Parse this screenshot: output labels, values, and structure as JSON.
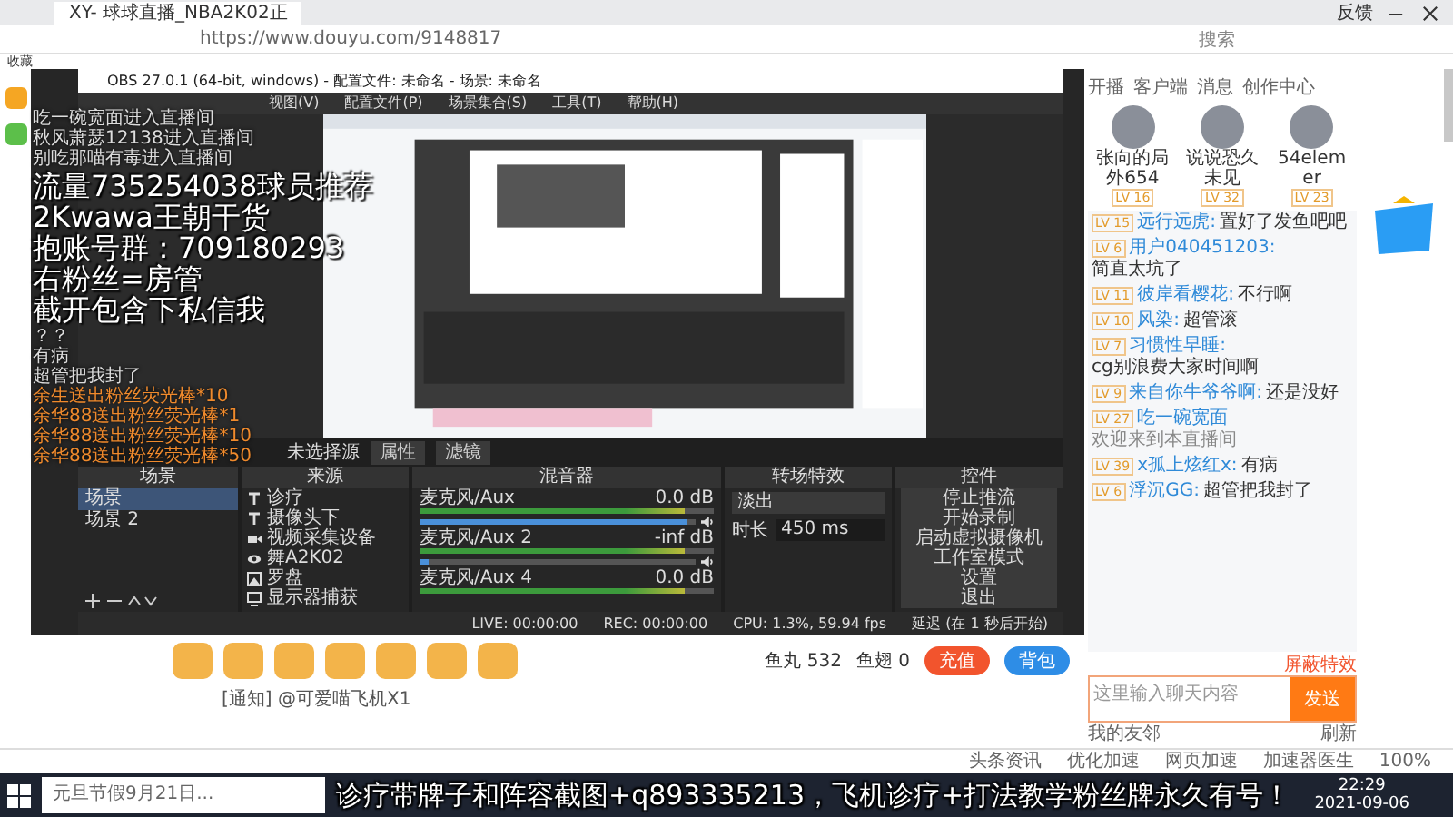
{
  "browser": {
    "tab_title": "XY- 球球直播_NBA2K02正",
    "feedback": "反馈",
    "url": "https://www.douyu.com/9148817",
    "search_placeholder": "搜索",
    "bookmarks": "收藏"
  },
  "site_nav": [
    {
      "label": "开播"
    },
    {
      "label": "客户端"
    },
    {
      "label": "消息"
    },
    {
      "label": "创作中心"
    }
  ],
  "obs": {
    "title": "OBS 27.0.1 (64-bit, windows) - 配置文件: 未命名 - 场景: 未命名",
    "menu": [
      "视图(V)",
      "配置文件(P)",
      "场景集合(S)",
      "工具(T)",
      "帮助(H)"
    ],
    "source_bar": {
      "label": "未选择源",
      "buttons": [
        "属性",
        "滤镜"
      ]
    },
    "scenes": {
      "title": "场景",
      "items": [
        {
          "label": "场景",
          "selected": true
        },
        {
          "label": "场景 2",
          "selected": false
        }
      ]
    },
    "sources": {
      "title": "来源",
      "items": [
        {
          "kind": "text",
          "label": "诊疗"
        },
        {
          "kind": "text",
          "label": "摄像头下"
        },
        {
          "kind": "camera",
          "label": "视频采集设备"
        },
        {
          "kind": "game",
          "label": "舞A2K02"
        },
        {
          "kind": "image",
          "label": "罗盘"
        },
        {
          "kind": "monitor",
          "label": "显示器捕获"
        }
      ]
    },
    "mixer": {
      "title": "混音器",
      "tracks": [
        {
          "name": "麦克风/Aux",
          "reading": "0.0 dB",
          "level": 0.97
        },
        {
          "name": "麦克风/Aux 2",
          "reading": "-inf dB",
          "level": 0.03
        },
        {
          "name": "麦克风/Aux 4",
          "reading": "0.0 dB"
        }
      ]
    },
    "transitions": {
      "title": "转场特效",
      "type": "淡出",
      "duration_label": "时长",
      "duration": "450 ms"
    },
    "controls": {
      "title": "控件",
      "buttons": [
        "停止推流",
        "开始录制",
        "启动虚拟摄像机",
        "工作室模式",
        "设置",
        "退出"
      ]
    },
    "status": {
      "live": "LIVE: 00:00:00",
      "rec": "REC: 00:00:00",
      "cpu": "CPU: 1.3%, 59.94 fps",
      "delay": "延迟 (在 1 秒后开始)"
    }
  },
  "overlay": {
    "enter_lines": [
      "吃一碗宽面进入直播间",
      "秋风萧瑟12138进入直播间",
      "别吃那喵有毒进入直播间"
    ],
    "promo_lines": [
      "流量735254038球员推荐",
      "2Kwawa王朝干货",
      "抱账号群：709180293",
      "右粉丝=房管",
      "截开包含下私信我"
    ],
    "chat_lines": [
      "？？",
      "有病",
      "超管把我封了"
    ],
    "gift_lines": [
      "余生送出粉丝荧光棒*10",
      "余华88送出粉丝荧光棒*1",
      "余华88送出粉丝荧光棒*10",
      "余华88送出粉丝荧光棒*50"
    ],
    "banner": "诊疗带牌子和阵容截图+q893335213，飞机诊疗+打法教学粉丝牌永久有号！"
  },
  "room": {
    "notice": "[通知] @可爱喵飞机X1",
    "fish_balls": "鱼丸 532",
    "fish_fins": "鱼翅 0",
    "recharge": "充值",
    "backpack": "背包"
  },
  "chat": {
    "top": [
      {
        "name": "张向的局外654",
        "level": "LV 16"
      },
      {
        "name": "说说恐久未见",
        "level": "LV 32"
      },
      {
        "name": "54elemer",
        "level": "LV 23"
      }
    ],
    "messages": [
      {
        "kind": "chat",
        "level": "LV 15",
        "user": "远行远虎:",
        "text": "置好了发鱼吧吧"
      },
      {
        "kind": "chat",
        "level": "LV 6",
        "user": "用户040451203:",
        "text": "简直太坑了"
      },
      {
        "kind": "chat",
        "level": "LV 11",
        "user": "彼岸看樱花:",
        "text": "不行啊"
      },
      {
        "kind": "chat",
        "level": "LV 10",
        "user": "风染:",
        "text": "超管滚"
      },
      {
        "kind": "chat",
        "level": "LV 7",
        "user": "习惯性早睡:",
        "text": "cg别浪费大家时间啊"
      },
      {
        "kind": "chat",
        "level": "LV 9",
        "user": "来自你牛爷爷啊:",
        "text": "还是没好"
      },
      {
        "kind": "welcome",
        "level": "LV 27",
        "user": "吃一碗宽面",
        "text": "欢迎来到本直播间"
      },
      {
        "kind": "chat",
        "level": "LV 39",
        "user": "x孤上炫红x:",
        "text": "有病"
      },
      {
        "kind": "chat",
        "level": "LV 6",
        "user": "浮沉GG:",
        "text": "超管把我封了"
      }
    ],
    "block": "屏蔽特效",
    "input_placeholder": "这里输入聊天内容",
    "send": "发送",
    "friends": "我的友邻",
    "refresh": "刷新"
  },
  "statusbar": [
    "头条资讯",
    "优化加速",
    "网页加速",
    "加速器医生",
    "100%"
  ],
  "taskbar": {
    "search_placeholder": "元旦节假9月21日...",
    "time": "22:29",
    "date": "2021-09-06"
  }
}
